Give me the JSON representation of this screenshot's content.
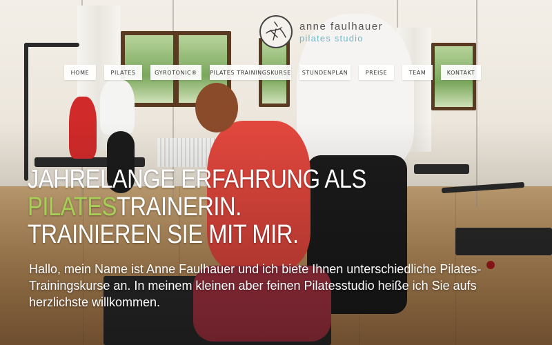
{
  "logo": {
    "name": "anne faulhauer",
    "subtitle": "pilates studio",
    "icon": "figure-sketch-icon",
    "name_color": "#555555",
    "subtitle_color": "#6fb7c9"
  },
  "nav": {
    "items": [
      {
        "label": "HOME"
      },
      {
        "label": "PILATES"
      },
      {
        "label": "GYROTONIC®"
      },
      {
        "label": "PILATES TRAININGSKURSE"
      },
      {
        "label": "STUNDENPLAN"
      },
      {
        "label": "PREISE"
      },
      {
        "label": "TEAM"
      },
      {
        "label": "KONTAKT"
      }
    ]
  },
  "hero": {
    "headline_line1": "JAHRELANGE ERFAHRUNG ALS",
    "headline_accent": "PILATES",
    "headline_line2_rest": "TRAINERIN.",
    "headline_line3": "TRAINIEREN SIE MIT MIR.",
    "intro": "Hallo, mein Name ist Anne Faulhauer und ich biete Ihnen unterschiedliche Pilates-Trainingskurse an. In meinem kleinen aber feinen Pilatesstudio heiße ich Sie aufs herzlichste willkommen.",
    "accent_color": "#a6cf55"
  }
}
